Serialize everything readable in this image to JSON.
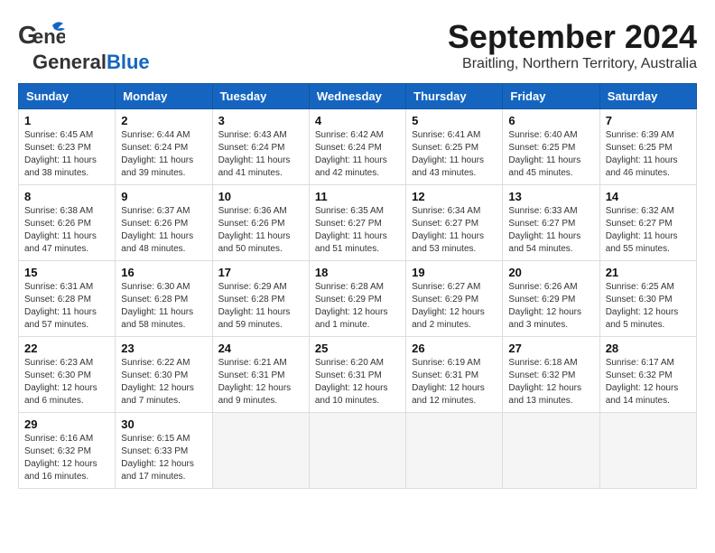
{
  "header": {
    "logo_general": "General",
    "logo_blue": "Blue",
    "month": "September 2024",
    "location": "Braitling, Northern Territory, Australia"
  },
  "weekdays": [
    "Sunday",
    "Monday",
    "Tuesday",
    "Wednesday",
    "Thursday",
    "Friday",
    "Saturday"
  ],
  "weeks": [
    [
      {
        "day": "1",
        "sunrise": "6:45 AM",
        "sunset": "6:23 PM",
        "daylight": "11 hours and 38 minutes."
      },
      {
        "day": "2",
        "sunrise": "6:44 AM",
        "sunset": "6:24 PM",
        "daylight": "11 hours and 39 minutes."
      },
      {
        "day": "3",
        "sunrise": "6:43 AM",
        "sunset": "6:24 PM",
        "daylight": "11 hours and 41 minutes."
      },
      {
        "day": "4",
        "sunrise": "6:42 AM",
        "sunset": "6:24 PM",
        "daylight": "11 hours and 42 minutes."
      },
      {
        "day": "5",
        "sunrise": "6:41 AM",
        "sunset": "6:25 PM",
        "daylight": "11 hours and 43 minutes."
      },
      {
        "day": "6",
        "sunrise": "6:40 AM",
        "sunset": "6:25 PM",
        "daylight": "11 hours and 45 minutes."
      },
      {
        "day": "7",
        "sunrise": "6:39 AM",
        "sunset": "6:25 PM",
        "daylight": "11 hours and 46 minutes."
      }
    ],
    [
      {
        "day": "8",
        "sunrise": "6:38 AM",
        "sunset": "6:26 PM",
        "daylight": "11 hours and 47 minutes."
      },
      {
        "day": "9",
        "sunrise": "6:37 AM",
        "sunset": "6:26 PM",
        "daylight": "11 hours and 48 minutes."
      },
      {
        "day": "10",
        "sunrise": "6:36 AM",
        "sunset": "6:26 PM",
        "daylight": "11 hours and 50 minutes."
      },
      {
        "day": "11",
        "sunrise": "6:35 AM",
        "sunset": "6:27 PM",
        "daylight": "11 hours and 51 minutes."
      },
      {
        "day": "12",
        "sunrise": "6:34 AM",
        "sunset": "6:27 PM",
        "daylight": "11 hours and 53 minutes."
      },
      {
        "day": "13",
        "sunrise": "6:33 AM",
        "sunset": "6:27 PM",
        "daylight": "11 hours and 54 minutes."
      },
      {
        "day": "14",
        "sunrise": "6:32 AM",
        "sunset": "6:27 PM",
        "daylight": "11 hours and 55 minutes."
      }
    ],
    [
      {
        "day": "15",
        "sunrise": "6:31 AM",
        "sunset": "6:28 PM",
        "daylight": "11 hours and 57 minutes."
      },
      {
        "day": "16",
        "sunrise": "6:30 AM",
        "sunset": "6:28 PM",
        "daylight": "11 hours and 58 minutes."
      },
      {
        "day": "17",
        "sunrise": "6:29 AM",
        "sunset": "6:28 PM",
        "daylight": "11 hours and 59 minutes."
      },
      {
        "day": "18",
        "sunrise": "6:28 AM",
        "sunset": "6:29 PM",
        "daylight": "12 hours and 1 minute."
      },
      {
        "day": "19",
        "sunrise": "6:27 AM",
        "sunset": "6:29 PM",
        "daylight": "12 hours and 2 minutes."
      },
      {
        "day": "20",
        "sunrise": "6:26 AM",
        "sunset": "6:29 PM",
        "daylight": "12 hours and 3 minutes."
      },
      {
        "day": "21",
        "sunrise": "6:25 AM",
        "sunset": "6:30 PM",
        "daylight": "12 hours and 5 minutes."
      }
    ],
    [
      {
        "day": "22",
        "sunrise": "6:23 AM",
        "sunset": "6:30 PM",
        "daylight": "12 hours and 6 minutes."
      },
      {
        "day": "23",
        "sunrise": "6:22 AM",
        "sunset": "6:30 PM",
        "daylight": "12 hours and 7 minutes."
      },
      {
        "day": "24",
        "sunrise": "6:21 AM",
        "sunset": "6:31 PM",
        "daylight": "12 hours and 9 minutes."
      },
      {
        "day": "25",
        "sunrise": "6:20 AM",
        "sunset": "6:31 PM",
        "daylight": "12 hours and 10 minutes."
      },
      {
        "day": "26",
        "sunrise": "6:19 AM",
        "sunset": "6:31 PM",
        "daylight": "12 hours and 12 minutes."
      },
      {
        "day": "27",
        "sunrise": "6:18 AM",
        "sunset": "6:32 PM",
        "daylight": "12 hours and 13 minutes."
      },
      {
        "day": "28",
        "sunrise": "6:17 AM",
        "sunset": "6:32 PM",
        "daylight": "12 hours and 14 minutes."
      }
    ],
    [
      {
        "day": "29",
        "sunrise": "6:16 AM",
        "sunset": "6:32 PM",
        "daylight": "12 hours and 16 minutes."
      },
      {
        "day": "30",
        "sunrise": "6:15 AM",
        "sunset": "6:33 PM",
        "daylight": "12 hours and 17 minutes."
      },
      null,
      null,
      null,
      null,
      null
    ]
  ],
  "labels": {
    "sunrise": "Sunrise:",
    "sunset": "Sunset:",
    "daylight": "Daylight:"
  }
}
